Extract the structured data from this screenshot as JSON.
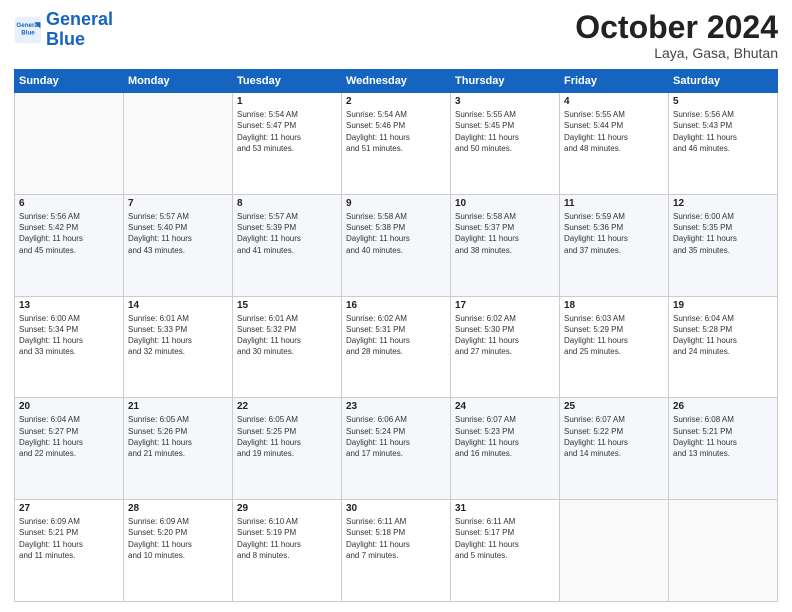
{
  "logo": {
    "line1": "General",
    "line2": "Blue"
  },
  "header": {
    "month": "October 2024",
    "location": "Laya, Gasa, Bhutan"
  },
  "weekdays": [
    "Sunday",
    "Monday",
    "Tuesday",
    "Wednesday",
    "Thursday",
    "Friday",
    "Saturday"
  ],
  "weeks": [
    [
      {
        "day": "",
        "info": ""
      },
      {
        "day": "",
        "info": ""
      },
      {
        "day": "1",
        "info": "Sunrise: 5:54 AM\nSunset: 5:47 PM\nDaylight: 11 hours\nand 53 minutes."
      },
      {
        "day": "2",
        "info": "Sunrise: 5:54 AM\nSunset: 5:46 PM\nDaylight: 11 hours\nand 51 minutes."
      },
      {
        "day": "3",
        "info": "Sunrise: 5:55 AM\nSunset: 5:45 PM\nDaylight: 11 hours\nand 50 minutes."
      },
      {
        "day": "4",
        "info": "Sunrise: 5:55 AM\nSunset: 5:44 PM\nDaylight: 11 hours\nand 48 minutes."
      },
      {
        "day": "5",
        "info": "Sunrise: 5:56 AM\nSunset: 5:43 PM\nDaylight: 11 hours\nand 46 minutes."
      }
    ],
    [
      {
        "day": "6",
        "info": "Sunrise: 5:56 AM\nSunset: 5:42 PM\nDaylight: 11 hours\nand 45 minutes."
      },
      {
        "day": "7",
        "info": "Sunrise: 5:57 AM\nSunset: 5:40 PM\nDaylight: 11 hours\nand 43 minutes."
      },
      {
        "day": "8",
        "info": "Sunrise: 5:57 AM\nSunset: 5:39 PM\nDaylight: 11 hours\nand 41 minutes."
      },
      {
        "day": "9",
        "info": "Sunrise: 5:58 AM\nSunset: 5:38 PM\nDaylight: 11 hours\nand 40 minutes."
      },
      {
        "day": "10",
        "info": "Sunrise: 5:58 AM\nSunset: 5:37 PM\nDaylight: 11 hours\nand 38 minutes."
      },
      {
        "day": "11",
        "info": "Sunrise: 5:59 AM\nSunset: 5:36 PM\nDaylight: 11 hours\nand 37 minutes."
      },
      {
        "day": "12",
        "info": "Sunrise: 6:00 AM\nSunset: 5:35 PM\nDaylight: 11 hours\nand 35 minutes."
      }
    ],
    [
      {
        "day": "13",
        "info": "Sunrise: 6:00 AM\nSunset: 5:34 PM\nDaylight: 11 hours\nand 33 minutes."
      },
      {
        "day": "14",
        "info": "Sunrise: 6:01 AM\nSunset: 5:33 PM\nDaylight: 11 hours\nand 32 minutes."
      },
      {
        "day": "15",
        "info": "Sunrise: 6:01 AM\nSunset: 5:32 PM\nDaylight: 11 hours\nand 30 minutes."
      },
      {
        "day": "16",
        "info": "Sunrise: 6:02 AM\nSunset: 5:31 PM\nDaylight: 11 hours\nand 28 minutes."
      },
      {
        "day": "17",
        "info": "Sunrise: 6:02 AM\nSunset: 5:30 PM\nDaylight: 11 hours\nand 27 minutes."
      },
      {
        "day": "18",
        "info": "Sunrise: 6:03 AM\nSunset: 5:29 PM\nDaylight: 11 hours\nand 25 minutes."
      },
      {
        "day": "19",
        "info": "Sunrise: 6:04 AM\nSunset: 5:28 PM\nDaylight: 11 hours\nand 24 minutes."
      }
    ],
    [
      {
        "day": "20",
        "info": "Sunrise: 6:04 AM\nSunset: 5:27 PM\nDaylight: 11 hours\nand 22 minutes."
      },
      {
        "day": "21",
        "info": "Sunrise: 6:05 AM\nSunset: 5:26 PM\nDaylight: 11 hours\nand 21 minutes."
      },
      {
        "day": "22",
        "info": "Sunrise: 6:05 AM\nSunset: 5:25 PM\nDaylight: 11 hours\nand 19 minutes."
      },
      {
        "day": "23",
        "info": "Sunrise: 6:06 AM\nSunset: 5:24 PM\nDaylight: 11 hours\nand 17 minutes."
      },
      {
        "day": "24",
        "info": "Sunrise: 6:07 AM\nSunset: 5:23 PM\nDaylight: 11 hours\nand 16 minutes."
      },
      {
        "day": "25",
        "info": "Sunrise: 6:07 AM\nSunset: 5:22 PM\nDaylight: 11 hours\nand 14 minutes."
      },
      {
        "day": "26",
        "info": "Sunrise: 6:08 AM\nSunset: 5:21 PM\nDaylight: 11 hours\nand 13 minutes."
      }
    ],
    [
      {
        "day": "27",
        "info": "Sunrise: 6:09 AM\nSunset: 5:21 PM\nDaylight: 11 hours\nand 11 minutes."
      },
      {
        "day": "28",
        "info": "Sunrise: 6:09 AM\nSunset: 5:20 PM\nDaylight: 11 hours\nand 10 minutes."
      },
      {
        "day": "29",
        "info": "Sunrise: 6:10 AM\nSunset: 5:19 PM\nDaylight: 11 hours\nand 8 minutes."
      },
      {
        "day": "30",
        "info": "Sunrise: 6:11 AM\nSunset: 5:18 PM\nDaylight: 11 hours\nand 7 minutes."
      },
      {
        "day": "31",
        "info": "Sunrise: 6:11 AM\nSunset: 5:17 PM\nDaylight: 11 hours\nand 5 minutes."
      },
      {
        "day": "",
        "info": ""
      },
      {
        "day": "",
        "info": ""
      }
    ]
  ]
}
